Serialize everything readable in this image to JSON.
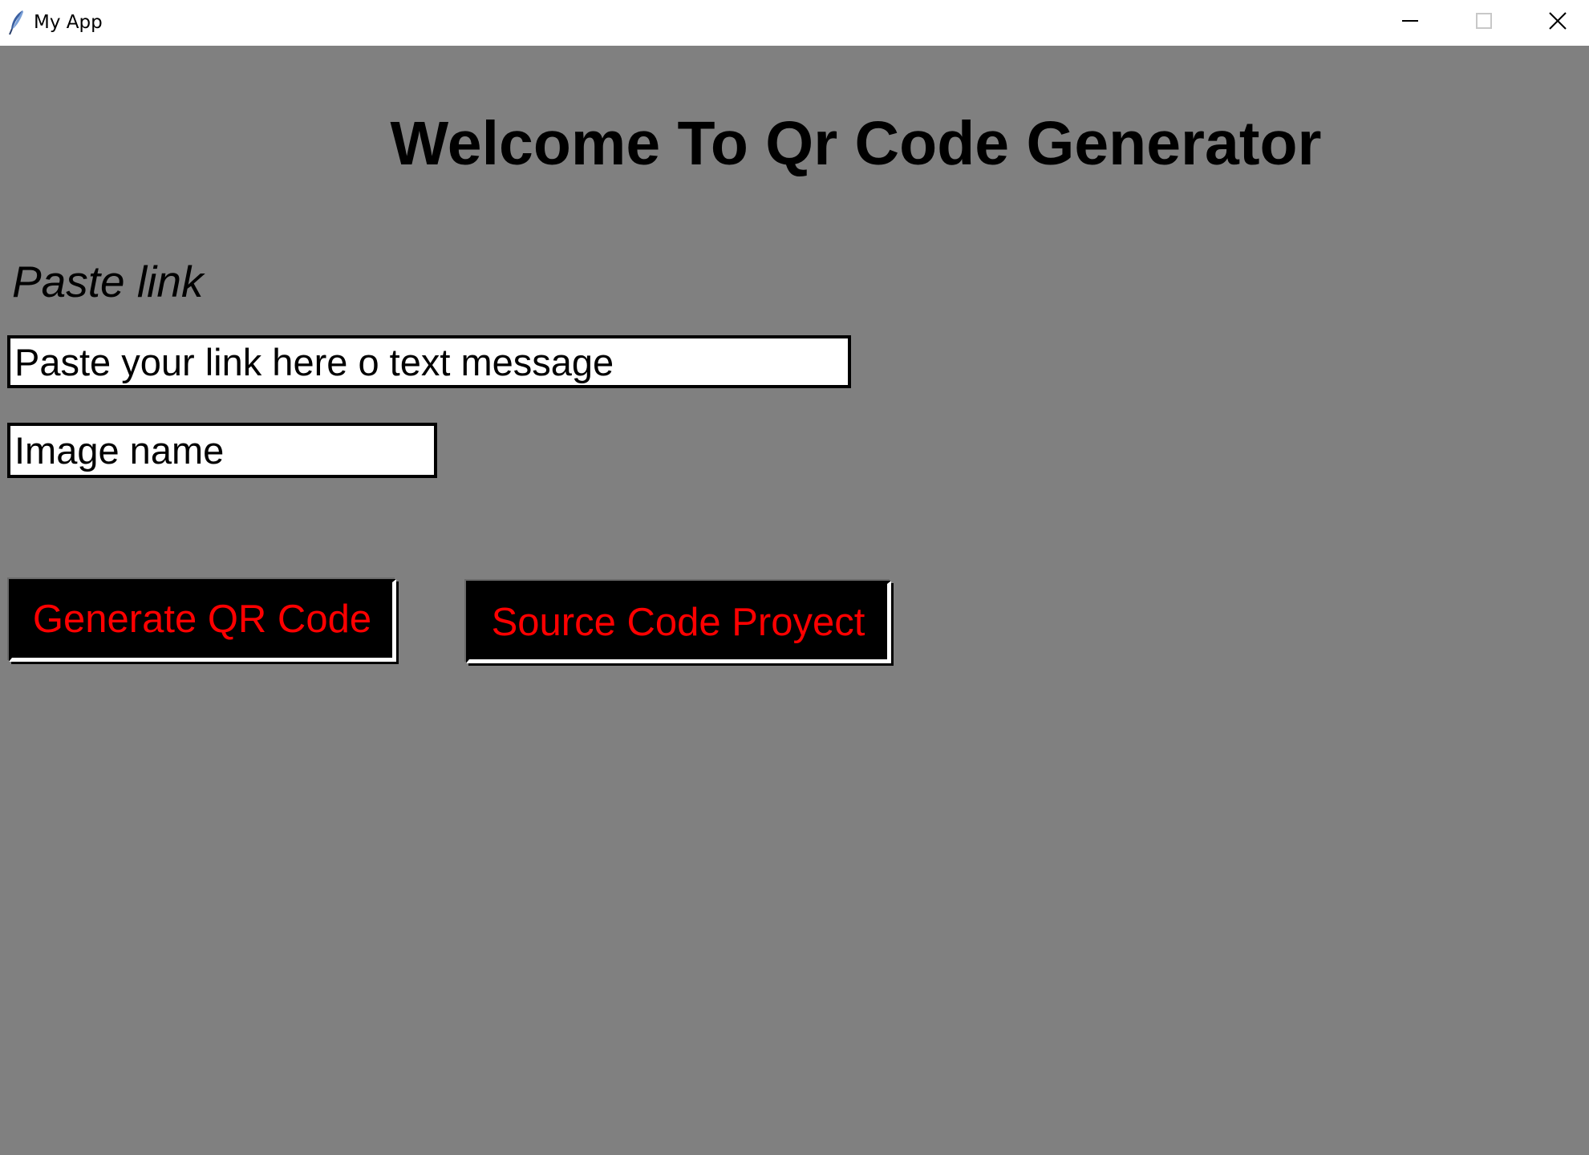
{
  "window": {
    "title": "My App",
    "controls": {
      "minimize_icon": "minimize-icon",
      "maximize_icon": "maximize-icon",
      "close_icon": "close-icon"
    }
  },
  "main": {
    "heading": "Welcome To Qr Code Generator",
    "paste_label": "Paste link",
    "link_field": {
      "value": "Paste your link here o text message"
    },
    "image_name_field": {
      "value": "Image name"
    },
    "generate_button": "Generate QR Code",
    "source_button": "Source Code Proyect"
  },
  "colors": {
    "background": "#808080",
    "button_background": "#000000",
    "button_text": "#ff0000",
    "titlebar": "#ffffff"
  }
}
